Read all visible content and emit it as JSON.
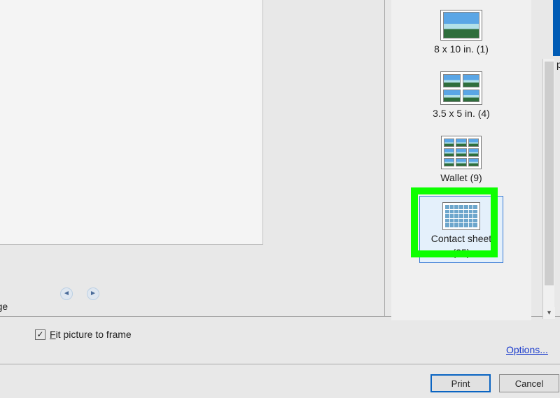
{
  "pager": {
    "label": "page",
    "prev_symbol": "◄",
    "next_symbol": "►"
  },
  "checkbox": {
    "label_pre": "F",
    "label_rest": "it picture to frame",
    "checked": true
  },
  "sidebar": {
    "templates": [
      {
        "id": "8x10",
        "label": "8 x 10 in. (1)",
        "grid": 1
      },
      {
        "id": "3p5x5",
        "label": "3.5 x 5 in. (4)",
        "grid": 4
      },
      {
        "id": "wallet",
        "label": "Wallet (9)",
        "grid": 9
      },
      {
        "id": "contact",
        "label_line1": "Contact sheet",
        "label_line2": "(35)",
        "grid": 35,
        "selected": true
      }
    ],
    "scroll_down_symbol": "▾"
  },
  "links": {
    "options": "Options..."
  },
  "buttons": {
    "print": "Print",
    "cancel": "Cancel"
  },
  "cropped_fragment": "p"
}
